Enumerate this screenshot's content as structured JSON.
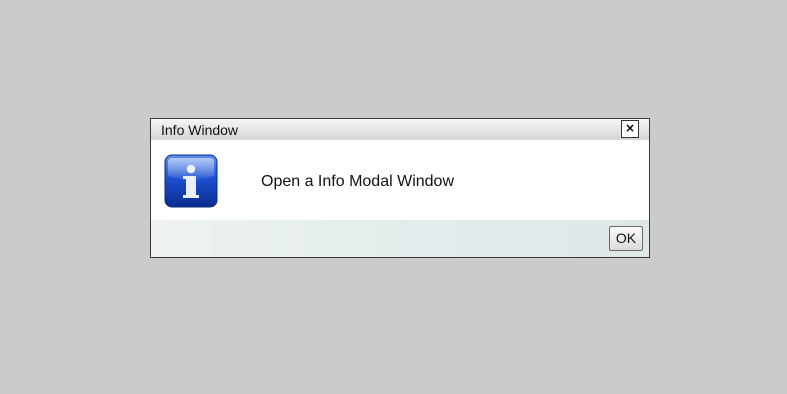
{
  "dialog": {
    "title": "Info Window",
    "close_label": "×",
    "message": "Open a Info Modal Window",
    "icon": "info-icon",
    "ok_label": "OK"
  },
  "colors": {
    "background": "#cbcbcb",
    "icon_blue": "#1d4fd0",
    "border": "#3a3a3a"
  }
}
